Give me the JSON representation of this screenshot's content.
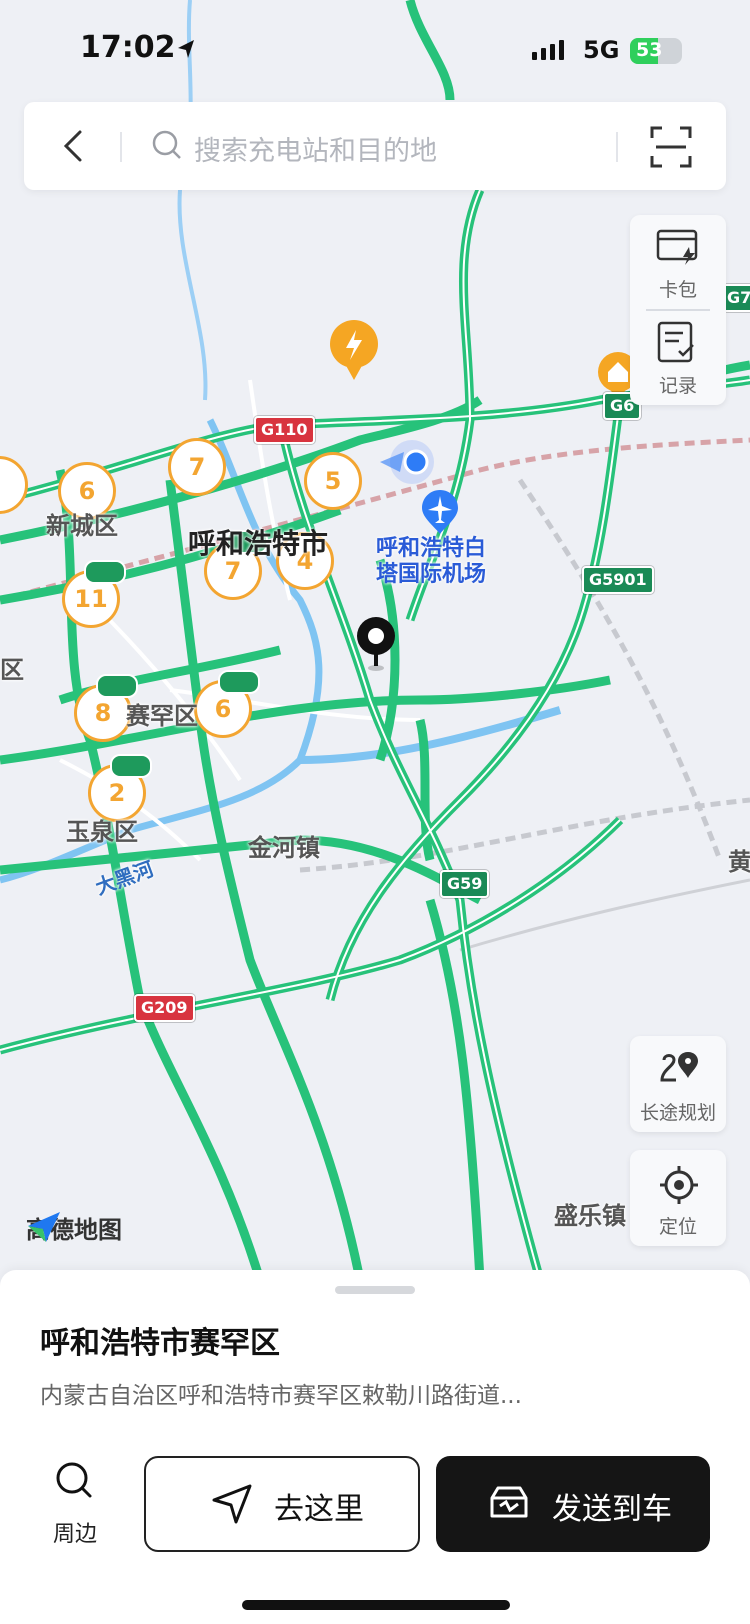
{
  "status_bar": {
    "time": "17:02",
    "network": "5G",
    "battery": "53",
    "battery_level": 0.53
  },
  "search": {
    "placeholder": "搜索充电站和目的地"
  },
  "side_panel": {
    "wallet_label": "卡包",
    "records_label": "记录"
  },
  "tools": {
    "route_label": "长途规划",
    "locate_label": "定位"
  },
  "map": {
    "labels": {
      "new_city": "新城区",
      "city": "呼和浩特市",
      "airport": "呼和浩特白塔国际机场",
      "saihan": "赛罕区",
      "yuquan": "玉泉区",
      "jinhe": "金河镇",
      "dahei_river": "大黑河",
      "shengle": "盛乐镇",
      "huang": "黄",
      "edge_district": "民区"
    },
    "road_shields": {
      "g110": "G110",
      "g6": "G6",
      "g5901": "G5901",
      "g59": "G59",
      "g209": "G209",
      "g7": "G7"
    },
    "clusters": [
      "6",
      "7",
      "5",
      "7",
      "4",
      "11",
      "8",
      "6",
      "2"
    ],
    "logo_text": "高德地图",
    "colors": {
      "road_green": "#27c27a",
      "cluster_orange": "#f3a531",
      "water_blue": "#7fc4f2"
    }
  },
  "sheet": {
    "title": "呼和浩特市赛罕区",
    "address": "内蒙古自治区呼和浩特市赛罕区敕勒川路街道...",
    "nearby_label": "周边",
    "go_label": "去这里",
    "send_label": "发送到车"
  }
}
